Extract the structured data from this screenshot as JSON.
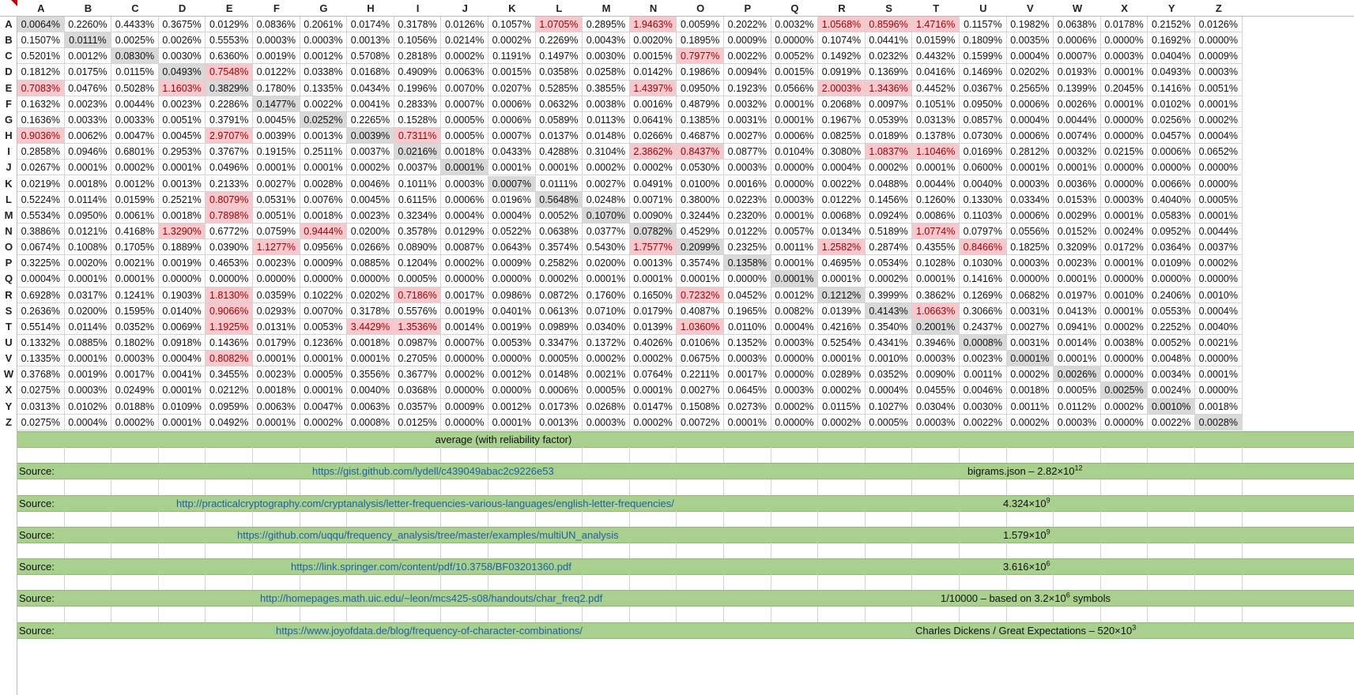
{
  "columns": [
    "A",
    "B",
    "C",
    "D",
    "E",
    "F",
    "G",
    "H",
    "I",
    "J",
    "K",
    "L",
    "M",
    "N",
    "O",
    "P",
    "Q",
    "R",
    "S",
    "T",
    "U",
    "V",
    "W",
    "X",
    "Y",
    "Z"
  ],
  "rows": [
    {
      "label": "A",
      "values": [
        "0.0064%",
        "0.2260%",
        "0.4433%",
        "0.3675%",
        "0.0129%",
        "0.0836%",
        "0.2061%",
        "0.0174%",
        "0.3178%",
        "0.0126%",
        "0.1057%",
        "1.0705%",
        "0.2895%",
        "1.9463%",
        "0.0059%",
        "0.2022%",
        "0.0032%",
        "1.0568%",
        "0.8596%",
        "1.4716%",
        "0.1157%",
        "0.1982%",
        "0.0638%",
        "0.0178%",
        "0.2152%",
        "0.0126%"
      ]
    },
    {
      "label": "B",
      "values": [
        "0.1507%",
        "0.0111%",
        "0.0025%",
        "0.0026%",
        "0.5553%",
        "0.0003%",
        "0.0003%",
        "0.0013%",
        "0.1056%",
        "0.0214%",
        "0.0002%",
        "0.2269%",
        "0.0043%",
        "0.0020%",
        "0.1895%",
        "0.0009%",
        "0.0000%",
        "0.1074%",
        "0.0441%",
        "0.0159%",
        "0.1809%",
        "0.0035%",
        "0.0006%",
        "0.0000%",
        "0.1692%",
        "0.0000%"
      ]
    },
    {
      "label": "C",
      "values": [
        "0.5201%",
        "0.0012%",
        "0.0830%",
        "0.0030%",
        "0.6360%",
        "0.0019%",
        "0.0012%",
        "0.5708%",
        "0.2818%",
        "0.0002%",
        "0.1191%",
        "0.1497%",
        "0.0030%",
        "0.0015%",
        "0.7977%",
        "0.0022%",
        "0.0052%",
        "0.1492%",
        "0.0232%",
        "0.4432%",
        "0.1599%",
        "0.0004%",
        "0.0007%",
        "0.0003%",
        "0.0404%",
        "0.0009%"
      ]
    },
    {
      "label": "D",
      "values": [
        "0.1812%",
        "0.0175%",
        "0.0115%",
        "0.0493%",
        "0.7548%",
        "0.0122%",
        "0.0338%",
        "0.0168%",
        "0.4909%",
        "0.0063%",
        "0.0015%",
        "0.0358%",
        "0.0258%",
        "0.0142%",
        "0.1986%",
        "0.0094%",
        "0.0015%",
        "0.0919%",
        "0.1369%",
        "0.0416%",
        "0.1469%",
        "0.0202%",
        "0.0193%",
        "0.0001%",
        "0.0493%",
        "0.0003%"
      ]
    },
    {
      "label": "E",
      "values": [
        "0.7083%",
        "0.0476%",
        "0.5028%",
        "1.1603%",
        "0.3829%",
        "0.1780%",
        "0.1335%",
        "0.0434%",
        "0.1996%",
        "0.0070%",
        "0.0207%",
        "0.5285%",
        "0.3855%",
        "1.4397%",
        "0.0950%",
        "0.1923%",
        "0.0566%",
        "2.0003%",
        "1.3436%",
        "0.4452%",
        "0.0367%",
        "0.2565%",
        "0.1399%",
        "0.2045%",
        "0.1416%",
        "0.0051%"
      ]
    },
    {
      "label": "F",
      "values": [
        "0.1632%",
        "0.0023%",
        "0.0044%",
        "0.0023%",
        "0.2286%",
        "0.1477%",
        "0.0022%",
        "0.0041%",
        "0.2833%",
        "0.0007%",
        "0.0006%",
        "0.0632%",
        "0.0038%",
        "0.0016%",
        "0.4879%",
        "0.0032%",
        "0.0001%",
        "0.2068%",
        "0.0097%",
        "0.1051%",
        "0.0950%",
        "0.0006%",
        "0.0026%",
        "0.0001%",
        "0.0102%",
        "0.0001%"
      ]
    },
    {
      "label": "G",
      "values": [
        "0.1636%",
        "0.0033%",
        "0.0033%",
        "0.0051%",
        "0.3791%",
        "0.0045%",
        "0.0252%",
        "0.2265%",
        "0.1528%",
        "0.0005%",
        "0.0006%",
        "0.0589%",
        "0.0113%",
        "0.0641%",
        "0.1385%",
        "0.0031%",
        "0.0001%",
        "0.1967%",
        "0.0539%",
        "0.0313%",
        "0.0857%",
        "0.0004%",
        "0.0044%",
        "0.0000%",
        "0.0256%",
        "0.0002%"
      ]
    },
    {
      "label": "H",
      "values": [
        "0.9036%",
        "0.0062%",
        "0.0047%",
        "0.0045%",
        "2.9707%",
        "0.0039%",
        "0.0013%",
        "0.0039%",
        "0.7311%",
        "0.0005%",
        "0.0007%",
        "0.0137%",
        "0.0148%",
        "0.0266%",
        "0.4687%",
        "0.0027%",
        "0.0006%",
        "0.0825%",
        "0.0189%",
        "0.1378%",
        "0.0730%",
        "0.0006%",
        "0.0074%",
        "0.0000%",
        "0.0457%",
        "0.0004%"
      ]
    },
    {
      "label": "I",
      "values": [
        "0.2858%",
        "0.0946%",
        "0.6801%",
        "0.2953%",
        "0.3767%",
        "0.1915%",
        "0.2511%",
        "0.0037%",
        "0.0216%",
        "0.0018%",
        "0.0433%",
        "0.4288%",
        "0.3104%",
        "2.3862%",
        "0.8437%",
        "0.0877%",
        "0.0104%",
        "0.3080%",
        "1.0837%",
        "1.1046%",
        "0.0169%",
        "0.2812%",
        "0.0032%",
        "0.0215%",
        "0.0006%",
        "0.0652%"
      ]
    },
    {
      "label": "J",
      "values": [
        "0.0267%",
        "0.0001%",
        "0.0002%",
        "0.0001%",
        "0.0496%",
        "0.0001%",
        "0.0001%",
        "0.0002%",
        "0.0037%",
        "0.0001%",
        "0.0001%",
        "0.0001%",
        "0.0002%",
        "0.0002%",
        "0.0530%",
        "0.0003%",
        "0.0000%",
        "0.0004%",
        "0.0002%",
        "0.0001%",
        "0.0600%",
        "0.0001%",
        "0.0001%",
        "0.0000%",
        "0.0000%",
        "0.0000%"
      ]
    },
    {
      "label": "K",
      "values": [
        "0.0219%",
        "0.0018%",
        "0.0012%",
        "0.0013%",
        "0.2133%",
        "0.0027%",
        "0.0028%",
        "0.0046%",
        "0.1011%",
        "0.0003%",
        "0.0007%",
        "0.0111%",
        "0.0027%",
        "0.0491%",
        "0.0100%",
        "0.0016%",
        "0.0000%",
        "0.0022%",
        "0.0488%",
        "0.0044%",
        "0.0040%",
        "0.0003%",
        "0.0036%",
        "0.0000%",
        "0.0066%",
        "0.0000%"
      ]
    },
    {
      "label": "L",
      "values": [
        "0.5224%",
        "0.0114%",
        "0.0159%",
        "0.2521%",
        "0.8079%",
        "0.0531%",
        "0.0076%",
        "0.0045%",
        "0.6115%",
        "0.0006%",
        "0.0196%",
        "0.5648%",
        "0.0248%",
        "0.0071%",
        "0.3800%",
        "0.0223%",
        "0.0003%",
        "0.0122%",
        "0.1456%",
        "0.1260%",
        "0.1330%",
        "0.0334%",
        "0.0153%",
        "0.0003%",
        "0.4040%",
        "0.0005%"
      ]
    },
    {
      "label": "M",
      "values": [
        "0.5534%",
        "0.0950%",
        "0.0061%",
        "0.0018%",
        "0.7898%",
        "0.0051%",
        "0.0018%",
        "0.0023%",
        "0.3234%",
        "0.0004%",
        "0.0004%",
        "0.0052%",
        "0.1070%",
        "0.0090%",
        "0.3244%",
        "0.2320%",
        "0.0001%",
        "0.0068%",
        "0.0924%",
        "0.0086%",
        "0.1103%",
        "0.0006%",
        "0.0029%",
        "0.0001%",
        "0.0583%",
        "0.0001%"
      ]
    },
    {
      "label": "N",
      "values": [
        "0.3886%",
        "0.0121%",
        "0.4168%",
        "1.3290%",
        "0.6772%",
        "0.0759%",
        "0.9444%",
        "0.0200%",
        "0.3578%",
        "0.0129%",
        "0.0522%",
        "0.0638%",
        "0.0377%",
        "0.0782%",
        "0.4529%",
        "0.0122%",
        "0.0057%",
        "0.0134%",
        "0.5189%",
        "1.0774%",
        "0.0797%",
        "0.0556%",
        "0.0152%",
        "0.0024%",
        "0.0952%",
        "0.0044%"
      ]
    },
    {
      "label": "O",
      "values": [
        "0.0674%",
        "0.1008%",
        "0.1705%",
        "0.1889%",
        "0.0390%",
        "1.1277%",
        "0.0956%",
        "0.0266%",
        "0.0890%",
        "0.0087%",
        "0.0643%",
        "0.3574%",
        "0.5430%",
        "1.7577%",
        "0.2099%",
        "0.2325%",
        "0.0011%",
        "1.2582%",
        "0.2874%",
        "0.4355%",
        "0.8466%",
        "0.1825%",
        "0.3209%",
        "0.0172%",
        "0.0364%",
        "0.0037%"
      ]
    },
    {
      "label": "P",
      "values": [
        "0.3225%",
        "0.0020%",
        "0.0021%",
        "0.0019%",
        "0.4653%",
        "0.0023%",
        "0.0009%",
        "0.0885%",
        "0.1204%",
        "0.0002%",
        "0.0009%",
        "0.2582%",
        "0.0200%",
        "0.0013%",
        "0.3574%",
        "0.1358%",
        "0.0001%",
        "0.4695%",
        "0.0534%",
        "0.1028%",
        "0.1030%",
        "0.0003%",
        "0.0023%",
        "0.0001%",
        "0.0109%",
        "0.0002%"
      ]
    },
    {
      "label": "Q",
      "values": [
        "0.0004%",
        "0.0001%",
        "0.0001%",
        "0.0000%",
        "0.0000%",
        "0.0000%",
        "0.0000%",
        "0.0000%",
        "0.0005%",
        "0.0000%",
        "0.0000%",
        "0.0002%",
        "0.0001%",
        "0.0001%",
        "0.0001%",
        "0.0000%",
        "0.0001%",
        "0.0001%",
        "0.0002%",
        "0.0001%",
        "0.1416%",
        "0.0000%",
        "0.0001%",
        "0.0000%",
        "0.0000%",
        "0.0000%"
      ]
    },
    {
      "label": "R",
      "values": [
        "0.6928%",
        "0.0317%",
        "0.1241%",
        "0.1903%",
        "1.8130%",
        "0.0359%",
        "0.1022%",
        "0.0202%",
        "0.7186%",
        "0.0017%",
        "0.0986%",
        "0.0872%",
        "0.1760%",
        "0.1650%",
        "0.7232%",
        "0.0452%",
        "0.0012%",
        "0.1212%",
        "0.3999%",
        "0.3862%",
        "0.1269%",
        "0.0682%",
        "0.0197%",
        "0.0010%",
        "0.2406%",
        "0.0010%"
      ]
    },
    {
      "label": "S",
      "values": [
        "0.2636%",
        "0.0200%",
        "0.1595%",
        "0.0140%",
        "0.9066%",
        "0.0293%",
        "0.0070%",
        "0.3178%",
        "0.5576%",
        "0.0019%",
        "0.0401%",
        "0.0613%",
        "0.0710%",
        "0.0179%",
        "0.4087%",
        "0.1965%",
        "0.0082%",
        "0.0139%",
        "0.4143%",
        "1.0663%",
        "0.3066%",
        "0.0031%",
        "0.0413%",
        "0.0001%",
        "0.0553%",
        "0.0004%"
      ]
    },
    {
      "label": "T",
      "values": [
        "0.5514%",
        "0.0114%",
        "0.0352%",
        "0.0069%",
        "1.1925%",
        "0.0131%",
        "0.0053%",
        "3.4429%",
        "1.3536%",
        "0.0014%",
        "0.0019%",
        "0.0989%",
        "0.0340%",
        "0.0139%",
        "1.0360%",
        "0.0110%",
        "0.0004%",
        "0.4216%",
        "0.3540%",
        "0.2001%",
        "0.2437%",
        "0.0027%",
        "0.0941%",
        "0.0002%",
        "0.2252%",
        "0.0040%"
      ]
    },
    {
      "label": "U",
      "values": [
        "0.1332%",
        "0.0885%",
        "0.1802%",
        "0.0918%",
        "0.1436%",
        "0.0179%",
        "0.1236%",
        "0.0018%",
        "0.0987%",
        "0.0007%",
        "0.0053%",
        "0.3347%",
        "0.1372%",
        "0.4026%",
        "0.0106%",
        "0.1352%",
        "0.0003%",
        "0.5254%",
        "0.4341%",
        "0.3946%",
        "0.0008%",
        "0.0031%",
        "0.0014%",
        "0.0038%",
        "0.0052%",
        "0.0021%"
      ]
    },
    {
      "label": "V",
      "values": [
        "0.1335%",
        "0.0001%",
        "0.0003%",
        "0.0004%",
        "0.8082%",
        "0.0001%",
        "0.0001%",
        "0.0001%",
        "0.2705%",
        "0.0000%",
        "0.0000%",
        "0.0005%",
        "0.0002%",
        "0.0002%",
        "0.0675%",
        "0.0003%",
        "0.0000%",
        "0.0001%",
        "0.0010%",
        "0.0003%",
        "0.0023%",
        "0.0001%",
        "0.0001%",
        "0.0000%",
        "0.0048%",
        "0.0000%"
      ]
    },
    {
      "label": "W",
      "values": [
        "0.3768%",
        "0.0019%",
        "0.0017%",
        "0.0041%",
        "0.3455%",
        "0.0023%",
        "0.0005%",
        "0.3556%",
        "0.3677%",
        "0.0002%",
        "0.0012%",
        "0.0148%",
        "0.0021%",
        "0.0764%",
        "0.2211%",
        "0.0017%",
        "0.0000%",
        "0.0289%",
        "0.0352%",
        "0.0090%",
        "0.0011%",
        "0.0002%",
        "0.0026%",
        "0.0000%",
        "0.0034%",
        "0.0001%"
      ]
    },
    {
      "label": "X",
      "values": [
        "0.0275%",
        "0.0003%",
        "0.0249%",
        "0.0001%",
        "0.0212%",
        "0.0018%",
        "0.0001%",
        "0.0040%",
        "0.0368%",
        "0.0000%",
        "0.0000%",
        "0.0006%",
        "0.0005%",
        "0.0001%",
        "0.0027%",
        "0.0645%",
        "0.0003%",
        "0.0002%",
        "0.0004%",
        "0.0455%",
        "0.0046%",
        "0.0018%",
        "0.0005%",
        "0.0025%",
        "0.0024%",
        "0.0000%"
      ]
    },
    {
      "label": "Y",
      "values": [
        "0.0313%",
        "0.0102%",
        "0.0188%",
        "0.0109%",
        "0.0959%",
        "0.0063%",
        "0.0047%",
        "0.0063%",
        "0.0357%",
        "0.0009%",
        "0.0012%",
        "0.0173%",
        "0.0268%",
        "0.0147%",
        "0.1508%",
        "0.0273%",
        "0.0002%",
        "0.0115%",
        "0.1027%",
        "0.0304%",
        "0.0030%",
        "0.0011%",
        "0.0112%",
        "0.0002%",
        "0.0010%",
        "0.0018%"
      ]
    },
    {
      "label": "Z",
      "values": [
        "0.0275%",
        "0.0004%",
        "0.0002%",
        "0.0001%",
        "0.0492%",
        "0.0001%",
        "0.0002%",
        "0.0008%",
        "0.0125%",
        "0.0000%",
        "0.0001%",
        "0.0013%",
        "0.0003%",
        "0.0002%",
        "0.0072%",
        "0.0001%",
        "0.0000%",
        "0.0002%",
        "0.0005%",
        "0.0003%",
        "0.0022%",
        "0.0002%",
        "0.0003%",
        "0.0000%",
        "0.0022%",
        "0.0028%"
      ]
    }
  ],
  "highlight_rule": "value >= 0.7% highlighted red; diagonal cells grey",
  "highlight_colors": {
    "diagonal": "#d9d9d9",
    "high": "#f8c8cc",
    "high_text": "#9a0006",
    "band": "#a9d08e",
    "link": "#1f5fa8"
  },
  "average_label": "average (with reliability factor)",
  "sources": [
    {
      "label": "Source:",
      "url": "https://gist.github.com/lydell/c439049abac2c9226e53",
      "note": "bigrams.json – 2.82×10",
      "note_sup": "12"
    },
    {
      "label": "Source:",
      "url": "http://practicalcryptography.com/cryptanalysis/letter-frequencies-various-languages/english-letter-frequencies/",
      "note": "4.324×10",
      "note_sup": "9"
    },
    {
      "label": "Source:",
      "url": "https://github.com/uqqu/frequency_analysis/tree/master/examples/multiUN_analysis",
      "note": "1.579×10",
      "note_sup": "9"
    },
    {
      "label": "Source:",
      "url": "https://link.springer.com/content/pdf/10.3758/BF03201360.pdf",
      "note": "3.616×10",
      "note_sup": "6"
    },
    {
      "label": "Source:",
      "url": "http://homepages.math.uic.edu/~leon/mcs425-s08/handouts/char_freq2.pdf",
      "note": "1/10000 – based on 3.2×10",
      "note_sup": "6",
      "note_tail": " symbols"
    },
    {
      "label": "Source:",
      "url": "https://www.joyofdata.de/blog/frequency-of-character-combinations/",
      "note": "Charles Dickens / Great Expectations – 520×10",
      "note_sup": "3"
    }
  ]
}
